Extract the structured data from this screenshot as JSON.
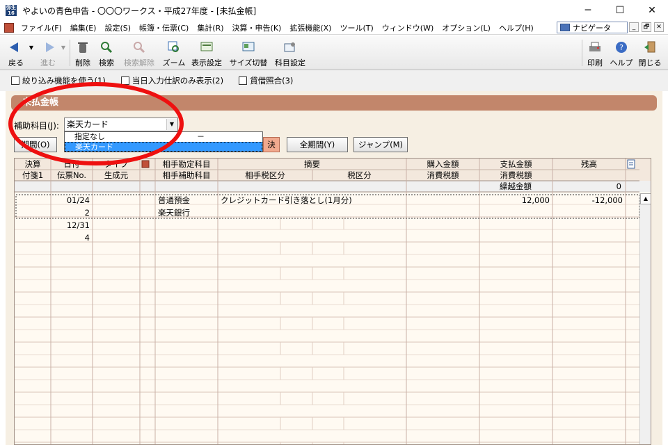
{
  "window": {
    "title": "やよいの青色申告 - 〇〇〇ワークス・平成27年度 - [未払金帳]",
    "icon_text": "弥生16",
    "minimize": "─",
    "maximize": "☐",
    "close": "✕"
  },
  "menu": {
    "items": [
      "ファイル(F)",
      "編集(E)",
      "設定(S)",
      "帳簿・伝票(C)",
      "集計(R)",
      "決算・申告(K)",
      "拡張機能(X)",
      "ツール(T)",
      "ウィンドウ(W)",
      "オプション(L)",
      "ヘルプ(H)"
    ],
    "navigator": "ナビゲータ",
    "mdi_min": "_",
    "mdi_restore": "🗗",
    "mdi_close": "✕"
  },
  "toolbar": {
    "back": "戻る",
    "forward": "進む",
    "delete": "削除",
    "search": "検索",
    "clear_search": "検索解除",
    "zoom": "ズーム",
    "display_settings": "表示設定",
    "size_toggle": "サイズ切替",
    "account_settings": "科目設定",
    "print": "印刷",
    "help": "ヘルプ",
    "close": "閉じる"
  },
  "filters": {
    "use_filter": "絞り込み機能を使う(1)",
    "today_only": "当日入力仕訳のみ表示(2)",
    "balance_ref": "貸借照合(3)"
  },
  "panel": {
    "title": "未払金帳",
    "sub_account_label": "補助科目(J):",
    "sub_account_value": "楽天カード",
    "period_btn": "期間(O)",
    "settle_btn": "決",
    "all_period_btn": "全期間(Y)",
    "jump_btn": "ジャンプ(M)"
  },
  "dropdown": {
    "options": [
      "指定なし",
      "楽天カード"
    ],
    "separator": "－",
    "selected_index": 1
  },
  "grid": {
    "header_row1": [
      "決算",
      "日付",
      "タイプ",
      "",
      "相手勘定科目",
      "摘要",
      "購入金額",
      "支払金額",
      "残高"
    ],
    "header_row2": [
      "付箋1",
      "伝票No.",
      "生成元",
      "相手補助科目",
      "相手税区分",
      "税区分",
      "消費税額",
      "消費税額"
    ],
    "carry_label": "繰越金額",
    "carry_value": "0",
    "rows": [
      {
        "date": "01/24",
        "no": "2",
        "account": "普通預金",
        "sub_account": "楽天銀行",
        "memo": "クレジットカード引き落とし(1月分)",
        "purchase": "",
        "payment": "12,000",
        "balance": "-12,000"
      },
      {
        "date": "12/31",
        "no": "4",
        "account": "",
        "sub_account": "",
        "memo": "",
        "purchase": "",
        "payment": "",
        "balance": ""
      }
    ]
  },
  "colors": {
    "header_band": "#c2866b",
    "panel_bg": "#f6efe3",
    "grid_bg": "#fffaf2",
    "annotation": "#ee1010",
    "selection": "#3399ff"
  }
}
